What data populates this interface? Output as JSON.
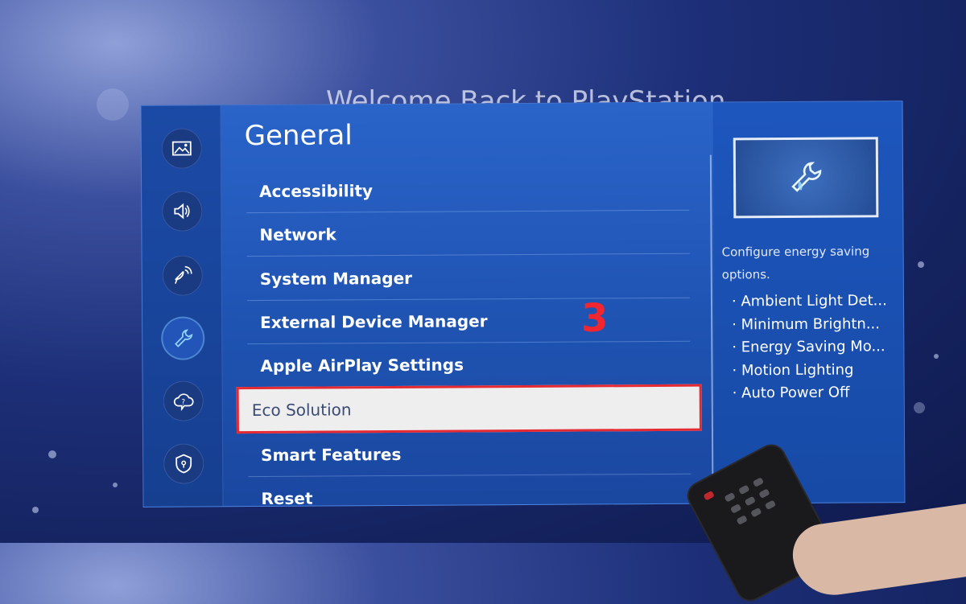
{
  "background": {
    "title": "Welcome Back to PlayStation"
  },
  "sidebar": {
    "items": [
      {
        "name": "picture",
        "icon": "picture-icon"
      },
      {
        "name": "sound",
        "icon": "speaker-icon"
      },
      {
        "name": "broadcasting",
        "icon": "satellite-dish-icon"
      },
      {
        "name": "general",
        "icon": "wrench-icon",
        "active": true
      },
      {
        "name": "support",
        "icon": "cloud-help-icon"
      },
      {
        "name": "privacy",
        "icon": "shield-lock-icon"
      }
    ]
  },
  "menu": {
    "title": "General",
    "items": [
      {
        "label": "Accessibility"
      },
      {
        "label": "Network"
      },
      {
        "label": "System Manager"
      },
      {
        "label": "External Device Manager"
      },
      {
        "label": "Apple AirPlay Settings"
      },
      {
        "label": "Eco Solution",
        "selected": true
      },
      {
        "label": "Smart Features"
      },
      {
        "label": "Reset"
      }
    ]
  },
  "detail": {
    "preview_icon": "eco-wrench-icon",
    "description": "Configure energy saving options.",
    "options": [
      "· Ambient Light Det...",
      "· Minimum Brightn...",
      "· Energy Saving Mo...",
      "· Motion Lighting",
      "· Auto Power Off"
    ]
  },
  "annotation": {
    "step": "3",
    "color": "#f2262f"
  },
  "colors": {
    "panel": "#2a64c9",
    "selection_border": "#e52a34",
    "selection_bg": "#eeeeee"
  }
}
